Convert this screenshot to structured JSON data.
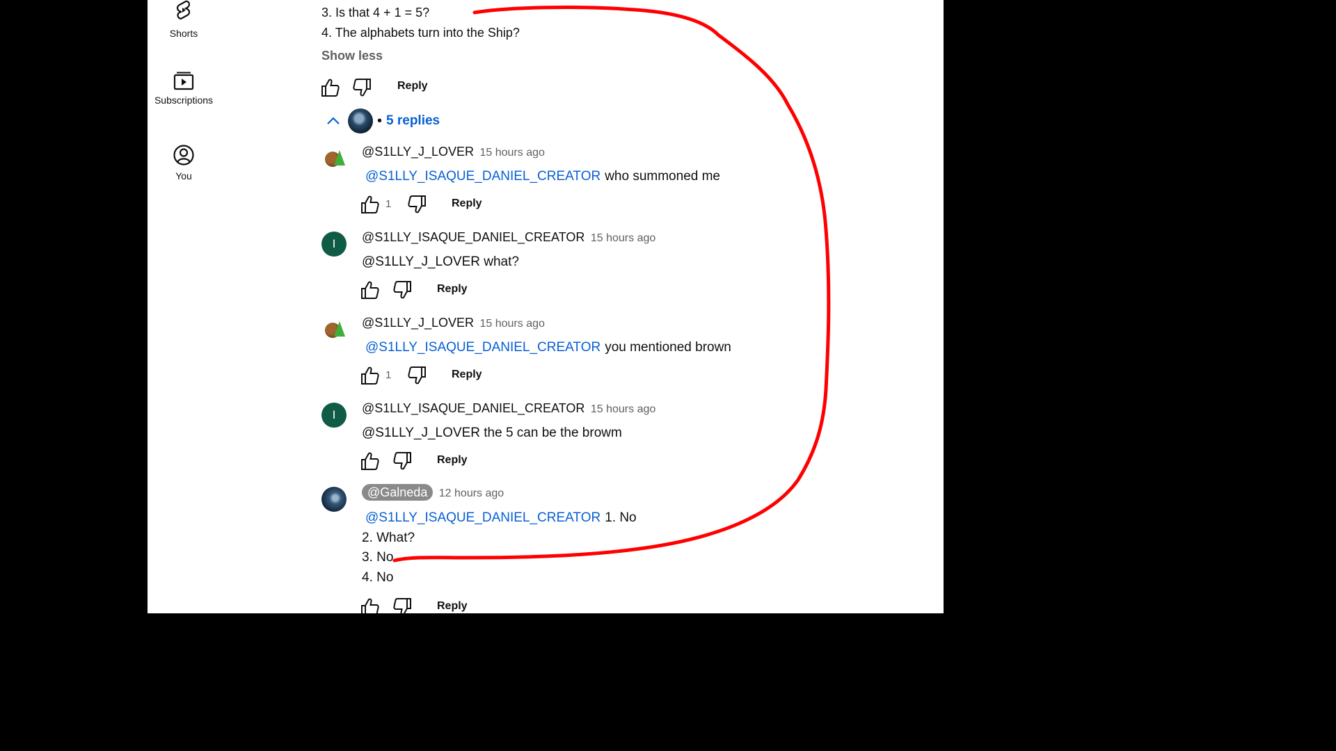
{
  "sidebar": {
    "items": [
      {
        "label": "Shorts",
        "icon": "shorts-icon"
      },
      {
        "label": "Subscriptions",
        "icon": "subscriptions-icon"
      },
      {
        "label": "You",
        "icon": "account-icon"
      }
    ]
  },
  "parent_comment": {
    "lines": [
      "3. Is that 4 + 1 = 5?",
      "4. The alphabets turn into the Ship?"
    ],
    "show_less": "Show less",
    "reply_label": "Reply"
  },
  "replies_toggle": {
    "label": "5 replies",
    "separator": "•"
  },
  "replies": [
    {
      "author": "@S1LLY_J_LOVER",
      "time": "15 hours ago",
      "mention": "@S1LLY_ISAQUE_DANIEL_CREATOR",
      "text": "who summoned me",
      "likes": "1",
      "reply_label": "Reply",
      "avatar_initial": ""
    },
    {
      "author": "@S1LLY_ISAQUE_DANIEL_CREATOR",
      "time": "15 hours ago",
      "text": "@S1LLY_J_LOVER  what?",
      "reply_label": "Reply",
      "avatar_initial": "I"
    },
    {
      "author": "@S1LLY_J_LOVER",
      "time": "15 hours ago",
      "mention": "@S1LLY_ISAQUE_DANIEL_CREATOR",
      "text": "you mentioned brown",
      "likes": "1",
      "reply_label": "Reply",
      "avatar_initial": ""
    },
    {
      "author": "@S1LLY_ISAQUE_DANIEL_CREATOR",
      "time": "15 hours ago",
      "text": "@S1LLY_J_LOVER  the 5 can be the browm",
      "reply_label": "Reply",
      "avatar_initial": "I"
    },
    {
      "author": "@Galneda",
      "time": "12 hours ago",
      "mention": "@S1LLY_ISAQUE_DANIEL_CREATOR",
      "text": "1. No",
      "extra_lines": [
        "2. What?",
        "3. No",
        "4. No"
      ],
      "reply_label": "Reply"
    }
  ],
  "colors": {
    "link": "#065fd4",
    "annotation": "#ff0000",
    "background": "#ffffff",
    "outer": "#000000"
  }
}
